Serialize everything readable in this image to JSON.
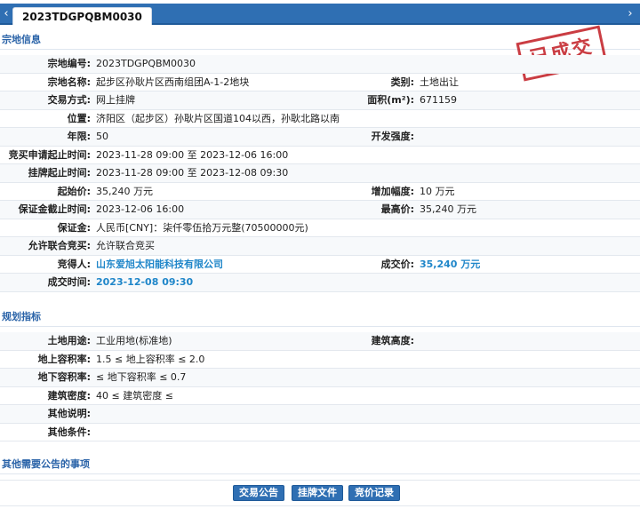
{
  "tab": {
    "title": "2023TDGPQBM0030"
  },
  "stamp": {
    "text": "已成交"
  },
  "sections": {
    "parcel": "宗地信息",
    "planning": "规划指标",
    "other": "其他需要公告的事项"
  },
  "parcel_rows": [
    {
      "label": "宗地编号:",
      "value": "2023TDGPQBM0030",
      "label2": "",
      "value2": ""
    },
    {
      "label": "宗地名称:",
      "value": "起步区孙耿片区西南组团A-1-2地块",
      "label2": "类别:",
      "value2": "土地出让"
    },
    {
      "label": "交易方式:",
      "value": "网上挂牌",
      "label2": "面积(m²):",
      "value2": "671159"
    },
    {
      "label": "位置:",
      "value": "济阳区（起步区）孙耿片区国道104以西，孙耿北路以南",
      "label2": "",
      "value2": ""
    },
    {
      "label": "年限:",
      "value": "50",
      "label2": "开发强度:",
      "value2": ""
    },
    {
      "label": "竞买申请起止时间:",
      "value": "2023-11-28 09:00 至 2023-12-06 16:00",
      "label2": "",
      "value2": ""
    },
    {
      "label": "挂牌起止时间:",
      "value": "2023-11-28 09:00 至 2023-12-08 09:30",
      "label2": "",
      "value2": ""
    },
    {
      "label": "起始价:",
      "value": "35,240 万元",
      "label2": "增加幅度:",
      "value2": "10 万元"
    },
    {
      "label": "保证金截止时间:",
      "value": "2023-12-06 16:00",
      "label2": "最高价:",
      "value2": "35,240 万元"
    },
    {
      "label": "保证金:",
      "value": "人民币[CNY]：柒仟零伍拾万元整(70500000元)",
      "label2": "",
      "value2": ""
    },
    {
      "label": "允许联合竞买:",
      "value": "允许联合竞买",
      "label2": "",
      "value2": ""
    },
    {
      "label": "竞得人:",
      "value": "山东爱旭太阳能科技有限公司",
      "label2": "成交价:",
      "value2": "35,240 万元"
    },
    {
      "label": "成交时间:",
      "value": "2023-12-08 09:30",
      "label2": "",
      "value2": ""
    }
  ],
  "planning_rows": [
    {
      "label": "土地用途:",
      "value": "工业用地(标准地)",
      "label2": "建筑高度:",
      "value2": ""
    },
    {
      "label": "地上容积率:",
      "value": "1.5 ≤ 地上容积率 ≤ 2.0",
      "label2": "",
      "value2": ""
    },
    {
      "label": "地下容积率:",
      "value": "≤ 地下容积率 ≤ 0.7",
      "label2": "",
      "value2": ""
    },
    {
      "label": "建筑密度:",
      "value": "40 ≤ 建筑密度 ≤",
      "label2": "",
      "value2": ""
    },
    {
      "label": "其他说明:",
      "value": "",
      "label2": "",
      "value2": ""
    },
    {
      "label": "其他条件:",
      "value": "",
      "label2": "",
      "value2": ""
    }
  ],
  "buttons": {
    "announcement": "交易公告",
    "listing_docs": "挂牌文件",
    "bid_records": "竞价记录"
  },
  "colors": {
    "accent": "#2f6fb3",
    "highlight": "#1f86c9",
    "stamp": "#c5292f"
  }
}
